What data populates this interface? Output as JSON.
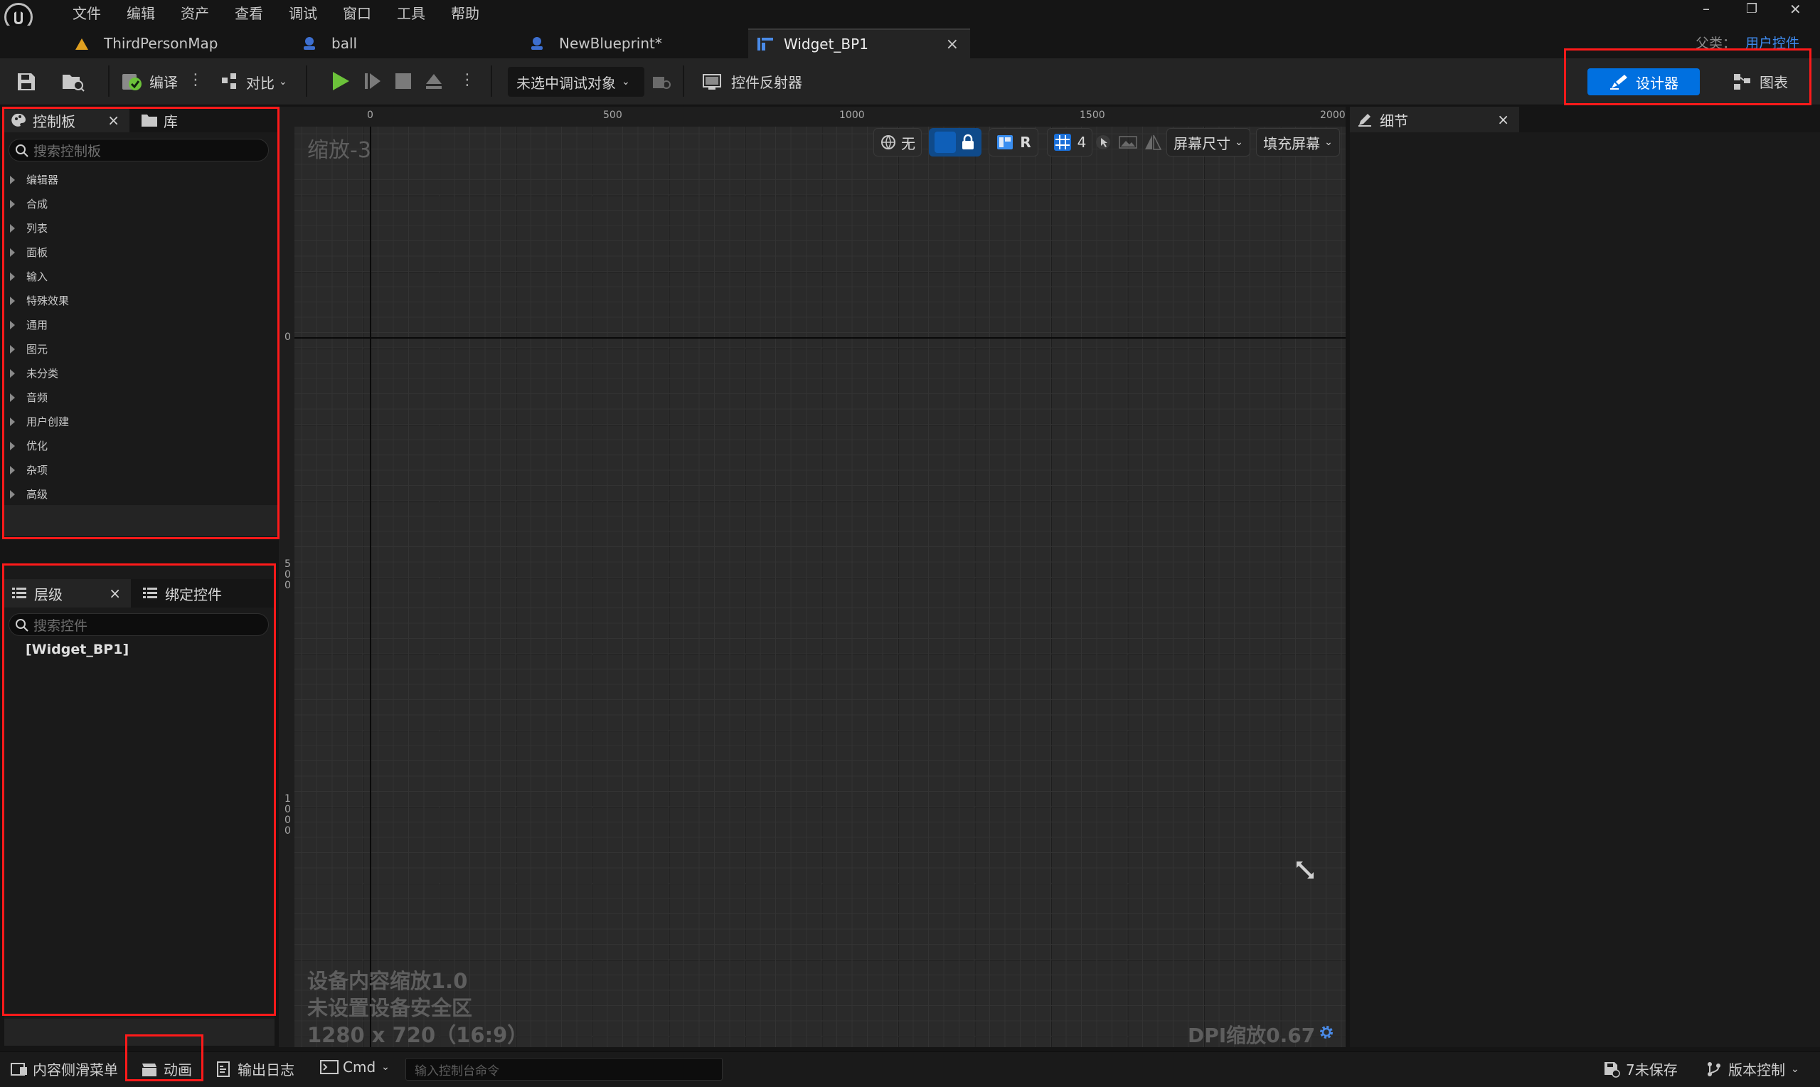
{
  "menu": [
    "文件",
    "编辑",
    "资产",
    "查看",
    "调试",
    "窗口",
    "工具",
    "帮助"
  ],
  "window_controls": {
    "minimize": "–",
    "restore": "❐",
    "close": "✕"
  },
  "tabs": [
    {
      "label": "ThirdPersonMap"
    },
    {
      "label": "ball"
    },
    {
      "label": "NewBlueprint*"
    },
    {
      "label": "Widget_BP1",
      "close": "×"
    }
  ],
  "parent": {
    "label": "父类：",
    "value": "用户控件"
  },
  "toolbar": {
    "compile": "编译",
    "diff": "对比",
    "debug_target": "未选中调试对象",
    "widget_reflector": "控件反射器",
    "designer": "设计器",
    "graph": "图表"
  },
  "palette": {
    "tab": "控制板",
    "library_tab": "库",
    "close": "×",
    "search_placeholder": "搜索控制板",
    "categories": [
      "编辑器",
      "合成",
      "列表",
      "面板",
      "输入",
      "特殊效果",
      "通用",
      "图元",
      "未分类",
      "音频",
      "用户创建",
      "优化",
      "杂项",
      "高级"
    ]
  },
  "hierarchy": {
    "tab": "层级",
    "bind_tab": "绑定控件",
    "close": "×",
    "search_placeholder": "搜索控件",
    "root": "[Widget_BP1]"
  },
  "details": {
    "tab": "细节",
    "close": "×"
  },
  "canvas": {
    "zoom": "缩放-3",
    "ruler_top": [
      "0",
      "500",
      "1000",
      "1500",
      "2000"
    ],
    "ruler_left": [
      "0",
      "500",
      "1000"
    ],
    "overlay": {
      "none": "无",
      "r": "R",
      "grid_size": "4",
      "screen_size": "屏幕尺寸",
      "fill_screen": "填充屏幕"
    },
    "device_scale": "设备内容缩放1.0",
    "safe_zone": "未设置设备安全区",
    "resolution": "1280 x 720（16:9）",
    "dpi": "DPI缩放0.67"
  },
  "statusbar": {
    "content_drawer": "内容侧滑菜单",
    "animation": "动画",
    "output_log": "输出日志",
    "cmd": "Cmd",
    "console_placeholder": "输入控制台命令",
    "unsaved": "7未保存",
    "source_control": "版本控制"
  },
  "colors": {
    "accent": "#0070e0",
    "highlight": "#ff1a1a",
    "play": "#6cc23a",
    "background": "#151515"
  }
}
